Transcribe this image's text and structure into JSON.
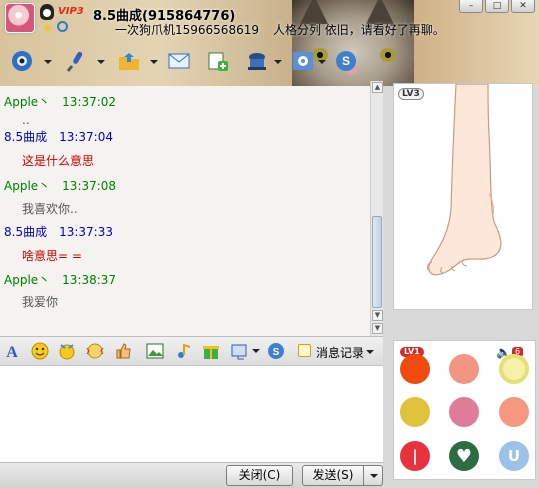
{
  "window": {
    "contact_name": "8.5曲成(915864776)",
    "signature_prefix": "一次狗爪机15966568619",
    "signature": "人格分列 依旧，请看好了再聊。",
    "vip_label": "VIP3"
  },
  "toolbar": {
    "items": [
      {
        "name": "video-call-icon"
      },
      {
        "name": "voice-call-icon"
      },
      {
        "name": "send-file-icon"
      },
      {
        "name": "send-mail-icon"
      },
      {
        "name": "create-group-icon"
      },
      {
        "name": "remote-assist-icon"
      },
      {
        "name": "app-settings-icon"
      },
      {
        "name": "more-apps-icon"
      }
    ]
  },
  "messages": [
    {
      "sender": "Apple丶",
      "time": "13:37:02",
      "text": "..",
      "sender_color": "green",
      "text_color": "gray"
    },
    {
      "sender": "8.5曲成",
      "time": "13:37:04",
      "text": "这是什么意思",
      "sender_color": "blue",
      "text_color": "red"
    },
    {
      "sender": "Apple丶",
      "time": "13:37:08",
      "text": "我喜欢你..",
      "sender_color": "green",
      "text_color": "gray"
    },
    {
      "sender": "8.5曲成",
      "time": "13:37:33",
      "text": "啥意思= =",
      "sender_color": "blue",
      "text_color": "red"
    },
    {
      "sender": "Apple丶",
      "time": "13:38:37",
      "text": "我爱你",
      "sender_color": "green",
      "text_color": "gray"
    }
  ],
  "input_toolbar": {
    "history_label": "消息记录"
  },
  "buttons": {
    "close": "关闭(C)",
    "send": "发送(S)"
  },
  "show_panel": {
    "level": "LV3"
  },
  "emo_panel": {
    "level": "LV1",
    "volume": "6",
    "dots": [
      {
        "color": "#f04a0f",
        "glyph": ""
      },
      {
        "color": "#f29683",
        "glyph": ""
      },
      {
        "color": "#f5f1a8",
        "glyph": ""
      },
      {
        "color": "#e0c23c",
        "glyph": ""
      },
      {
        "color": "#de7d99",
        "glyph": ""
      },
      {
        "color": "#f5987e",
        "glyph": ""
      },
      {
        "color": "#e8323e",
        "glyph": "|"
      },
      {
        "color": "#2d6b40",
        "glyph": "♥"
      },
      {
        "color": "#9cc2e8",
        "glyph": "U"
      }
    ]
  },
  "colors": {
    "sender_green": "#008000",
    "sender_blue": "#0000c8",
    "text_red": "#d00000",
    "text_gray": "#555555"
  }
}
